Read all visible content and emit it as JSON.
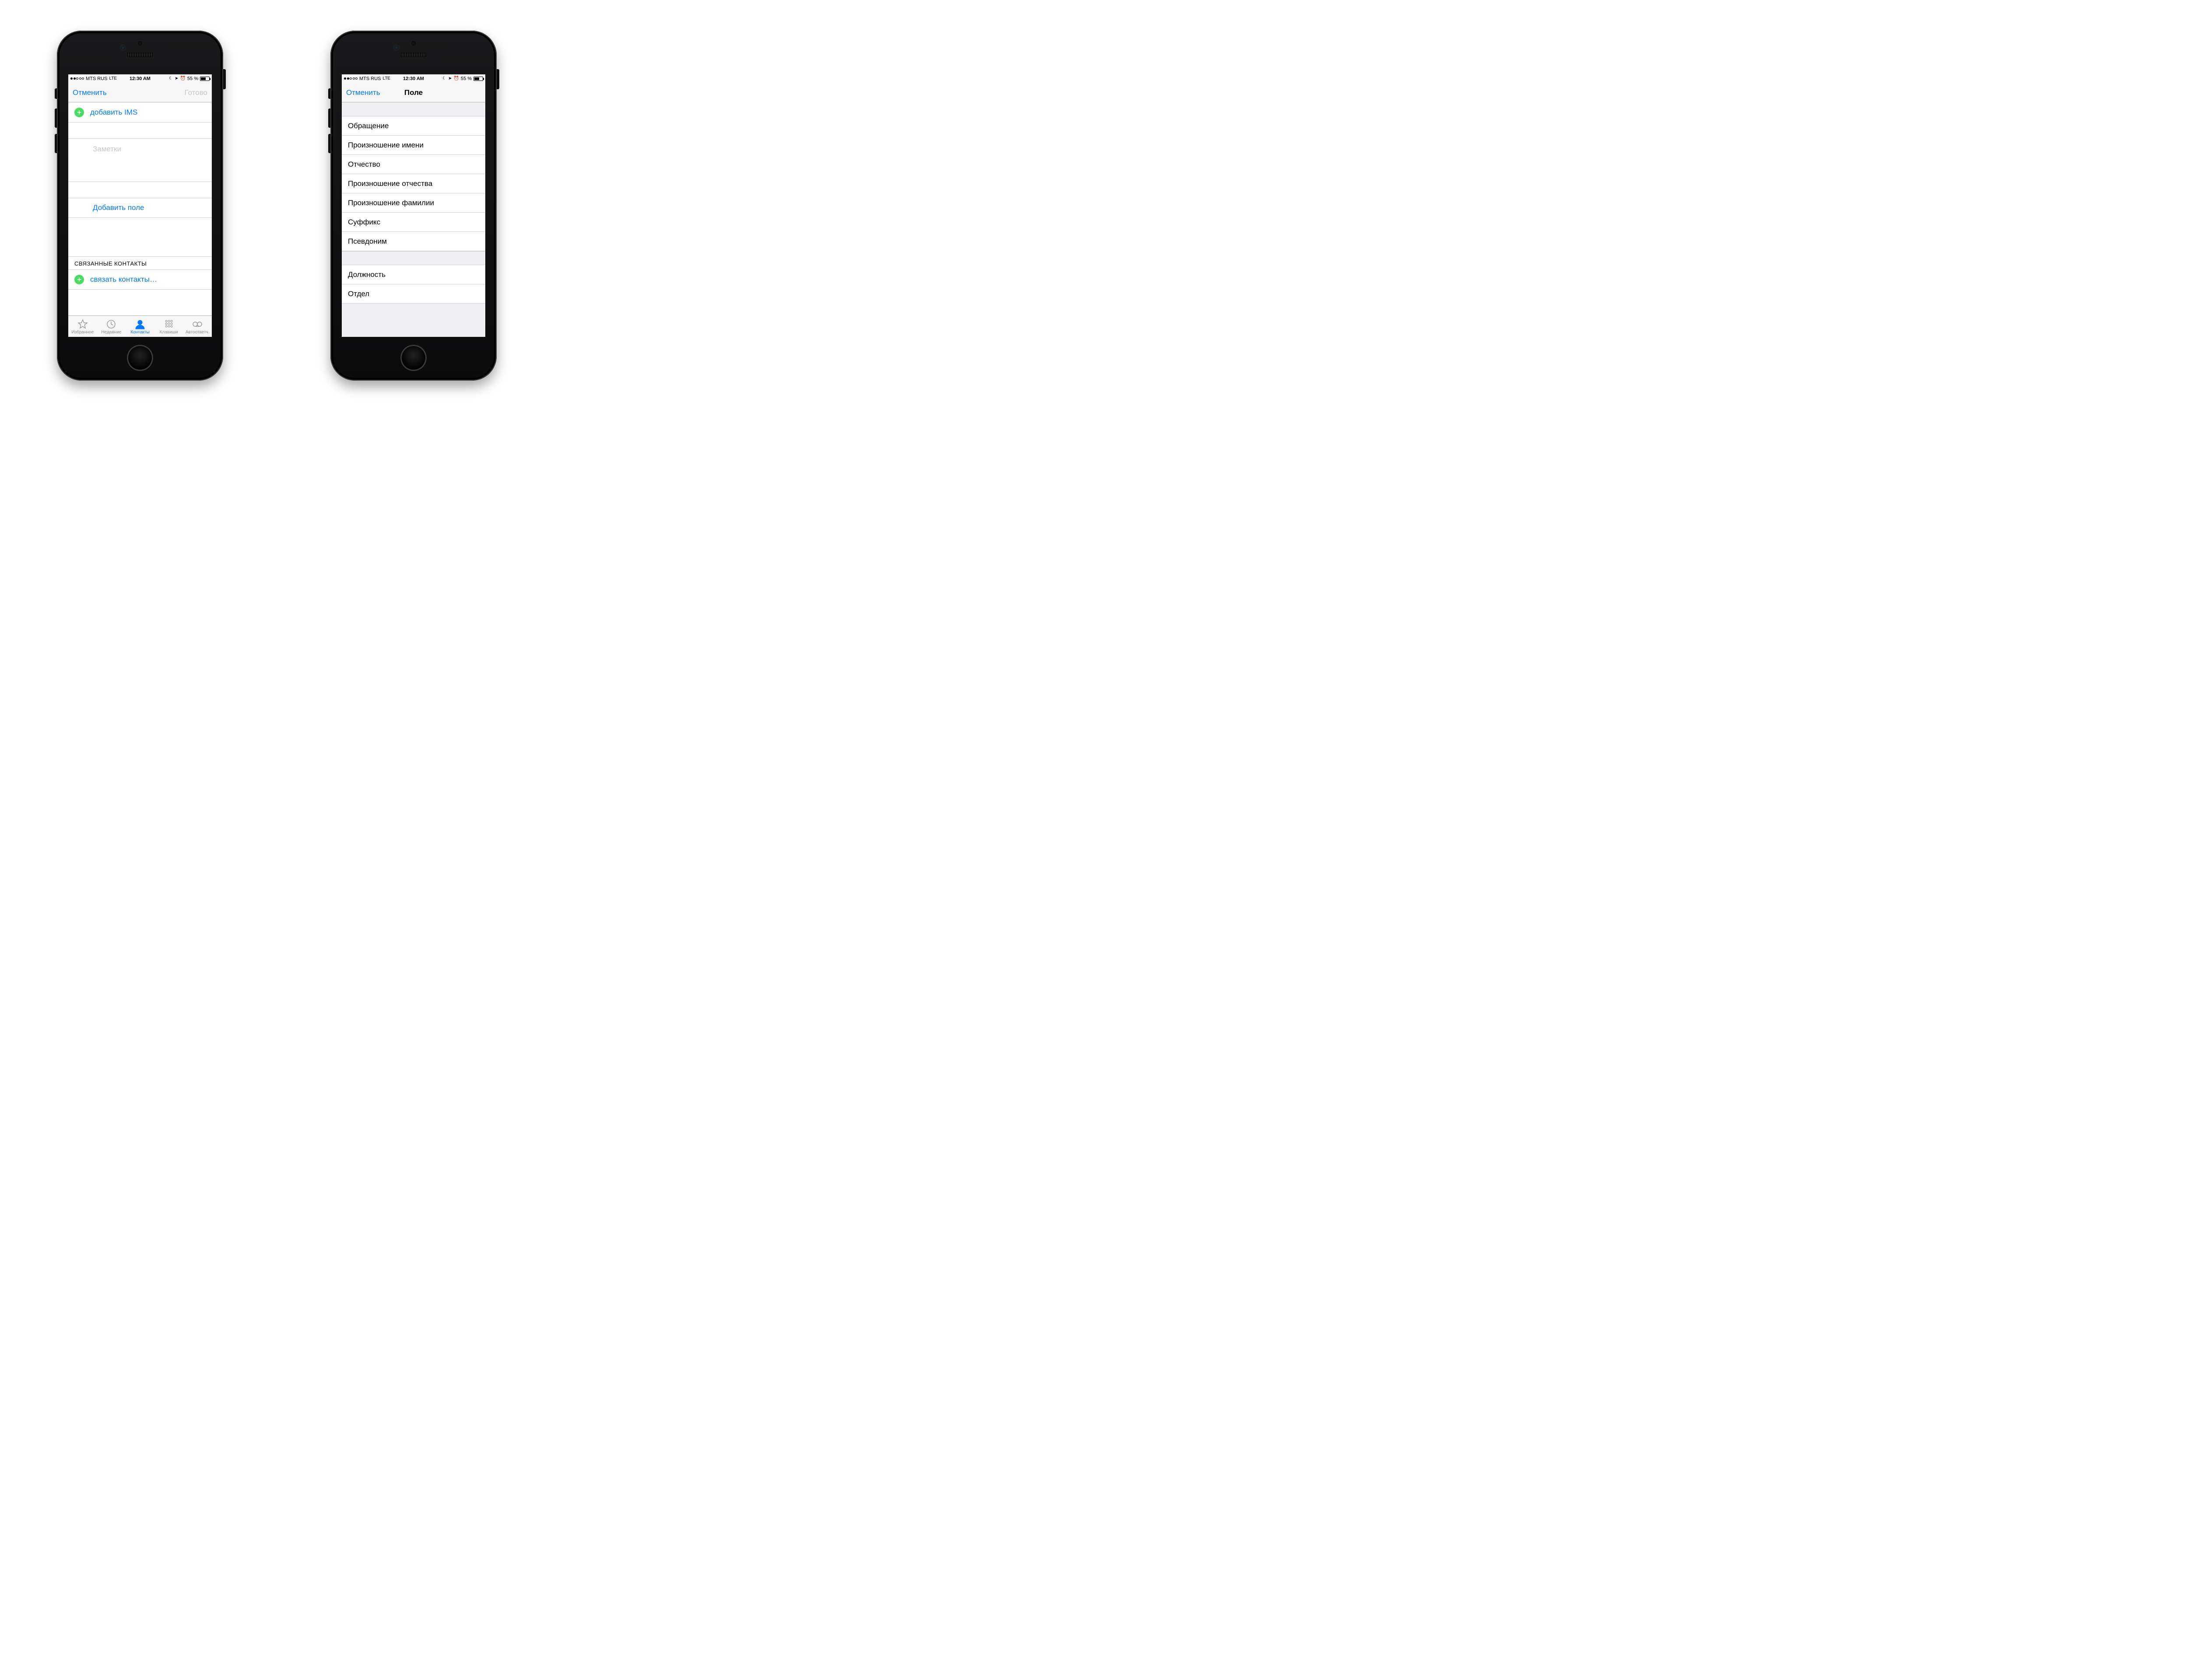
{
  "status": {
    "carrier": "MTS RUS",
    "network": "LTE",
    "time": "12:30 AM",
    "battery_pct": "55 %"
  },
  "left_phone": {
    "nav": {
      "cancel": "Отменить",
      "done": "Готово"
    },
    "add_ims": "добавить IMS",
    "notes_placeholder": "Заметки",
    "add_field": "Добавить поле",
    "linked_header": "СВЯЗАННЫЕ КОНТАКТЫ",
    "link_contacts": "связать контакты…",
    "tabs": {
      "favorites": "Избранное",
      "recents": "Недавние",
      "contacts": "Контакты",
      "keypad": "Клавиши",
      "voicemail": "Автоответч."
    }
  },
  "right_phone": {
    "nav": {
      "cancel": "Отменить",
      "title": "Поле"
    },
    "group1": [
      "Обращение",
      "Произношение имени",
      "Отчество",
      "Произношение отчества",
      "Произношение фамилии",
      "Суффикс",
      "Псевдоним"
    ],
    "group2": [
      "Должность",
      "Отдел"
    ]
  }
}
